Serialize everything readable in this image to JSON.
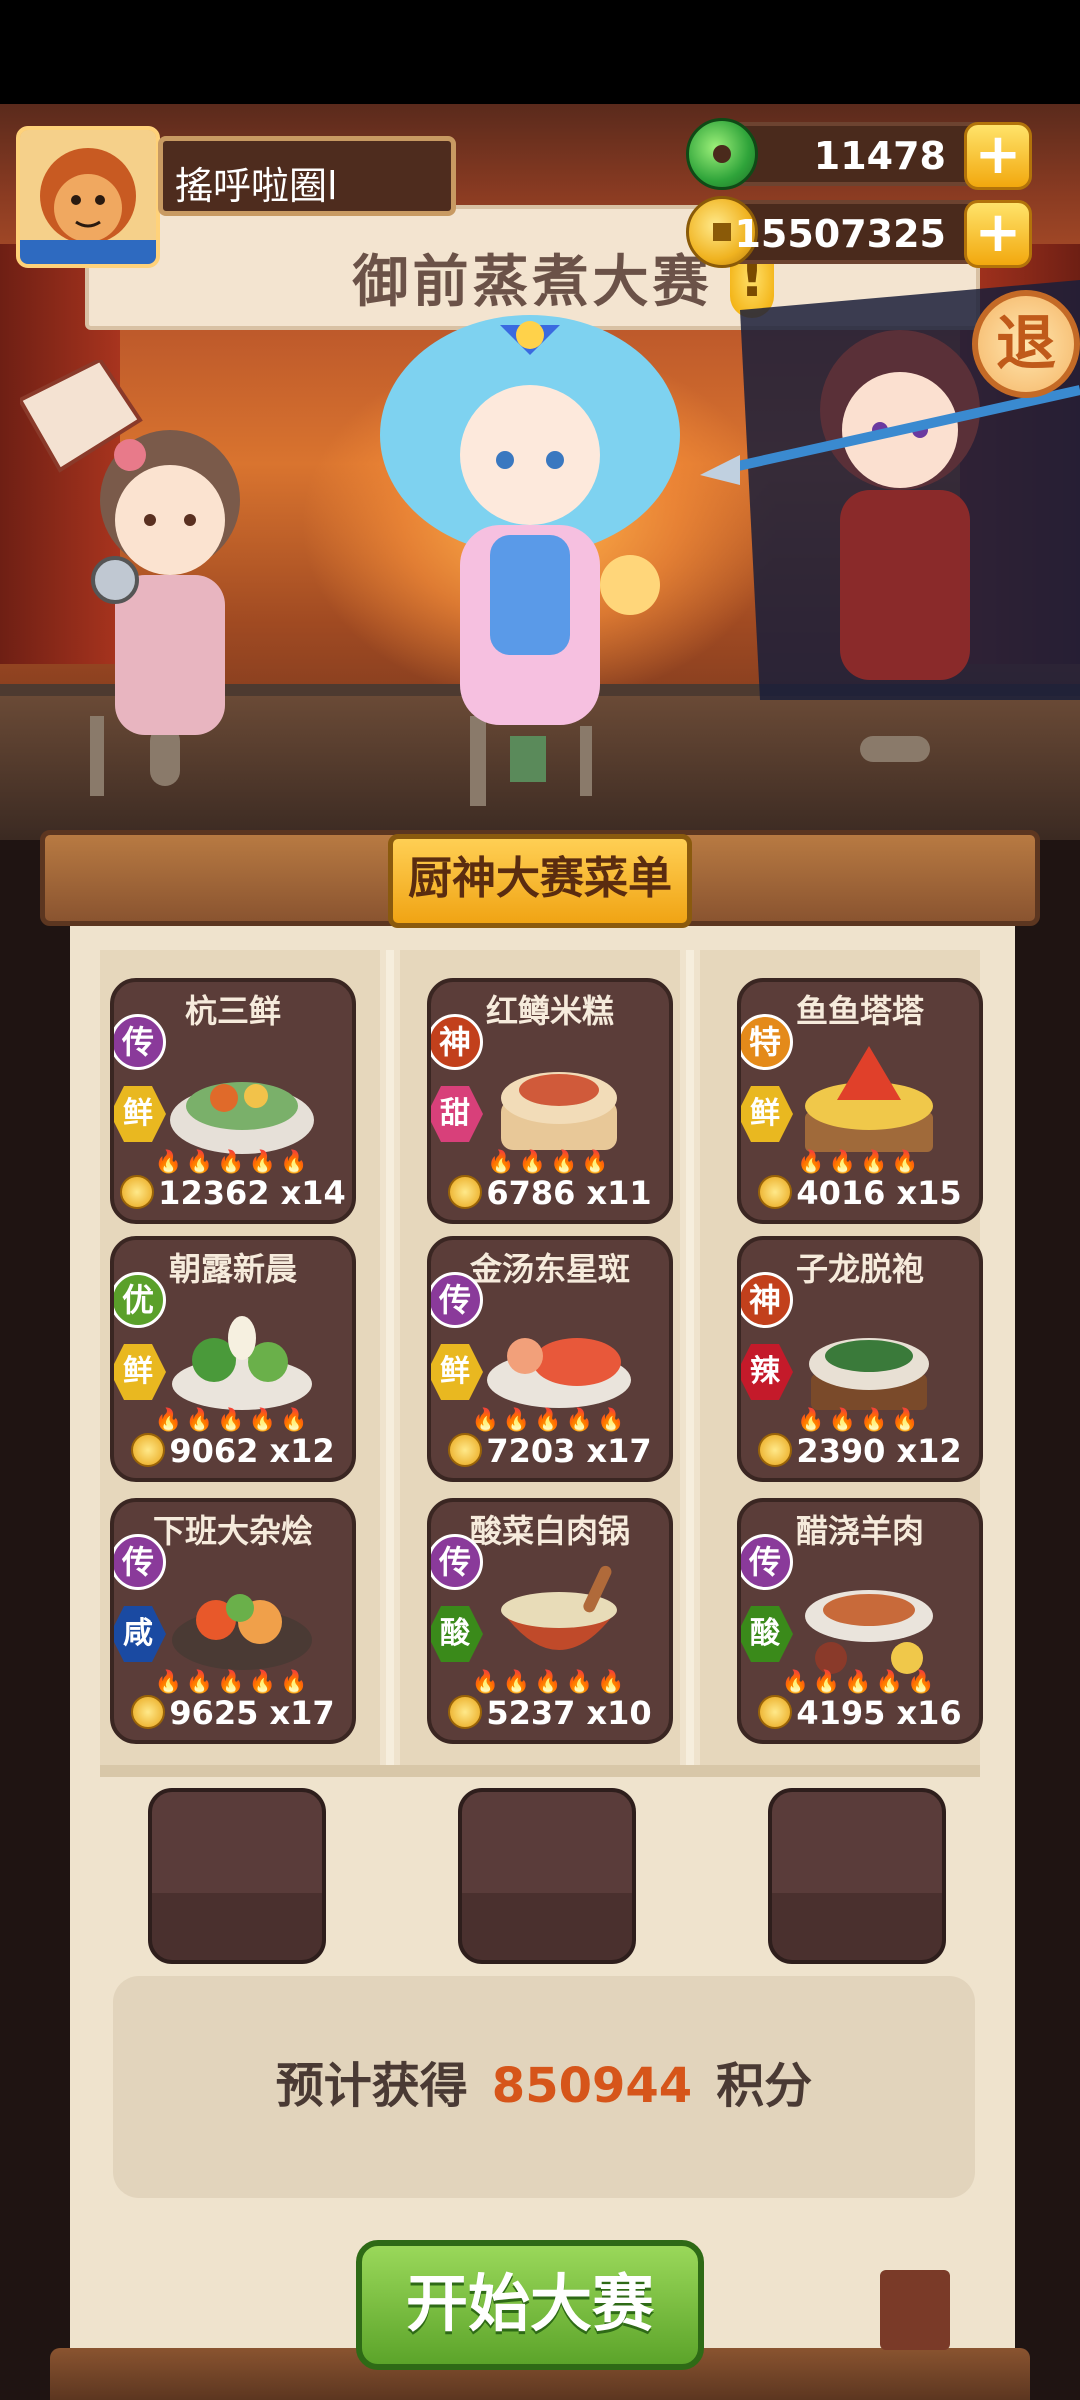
{
  "player": {
    "name": "搖呼啦圈l"
  },
  "currency": {
    "jade": "11478",
    "gold": "15507325",
    "plus_label": "+"
  },
  "exit_label": "退",
  "banner": {
    "title": "御前蒸煮大赛",
    "alert": "!"
  },
  "menu": {
    "title": "厨神大赛菜单",
    "dishes": [
      {
        "name": "杭三鲜",
        "grade": "传",
        "grade_color": "#8a3a9a",
        "taste": "鲜",
        "taste_color": "#e9b820",
        "flames": "🔥🔥🔥🔥🔥",
        "price": "12362",
        "count": "x14"
      },
      {
        "name": "红鳟米糕",
        "grade": "神",
        "grade_color": "#c2401c",
        "taste": "甜",
        "taste_color": "#d8407a",
        "flames": "🔥🔥🔥🔥",
        "price": "6786",
        "count": "x11"
      },
      {
        "name": "鱼鱼塔塔",
        "grade": "特",
        "grade_color": "#e48a1a",
        "taste": "鲜",
        "taste_color": "#e9b820",
        "flames": "🔥🔥🔥🔥",
        "price": "4016",
        "count": "x15"
      },
      {
        "name": "朝露新晨",
        "grade": "优",
        "grade_color": "#5aa02a",
        "taste": "鲜",
        "taste_color": "#e9b820",
        "flames": "🔥🔥🔥🔥🔥",
        "price": "9062",
        "count": "x12"
      },
      {
        "name": "金汤东星斑",
        "grade": "传",
        "grade_color": "#8a3a9a",
        "taste": "鲜",
        "taste_color": "#e9b820",
        "flames": "🔥🔥🔥🔥🔥",
        "price": "7203",
        "count": "x17"
      },
      {
        "name": "子龙脱袍",
        "grade": "神",
        "grade_color": "#c2401c",
        "taste": "辣",
        "taste_color": "#c41a2a",
        "flames": "🔥🔥🔥🔥",
        "price": "2390",
        "count": "x12"
      },
      {
        "name": "下班大杂烩",
        "grade": "传",
        "grade_color": "#8a3a9a",
        "taste": "咸",
        "taste_color": "#1a4aa2",
        "flames": "🔥🔥🔥🔥🔥",
        "price": "9625",
        "count": "x17"
      },
      {
        "name": "酸菜白肉锅",
        "grade": "传",
        "grade_color": "#8a3a9a",
        "taste": "酸",
        "taste_color": "#3a8a1a",
        "flames": "🔥🔥🔥🔥🔥",
        "price": "5237",
        "count": "x10"
      },
      {
        "name": "醋浇羊肉",
        "grade": "传",
        "grade_color": "#8a3a9a",
        "taste": "酸",
        "taste_color": "#3a8a1a",
        "flames": "🔥🔥🔥🔥🔥",
        "price": "4195",
        "count": "x16"
      }
    ]
  },
  "estimate": {
    "prefix": "预计获得",
    "value": "850944",
    "suffix": "积分"
  },
  "start_label": "开始大赛"
}
